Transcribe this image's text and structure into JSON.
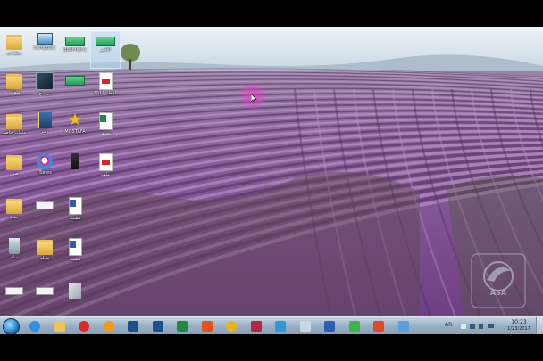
{
  "desktop": {
    "wallpaper": "lavender-field",
    "icons": [
      {
        "name": "folder-icon-1",
        "kind": "folder",
        "label": "مجلداتي"
      },
      {
        "name": "computer-icon",
        "kind": "computer",
        "label": "Computer"
      },
      {
        "name": "green-app-icon-1",
        "kind": "green",
        "label": "Bukhfed-1"
      },
      {
        "name": "green-app-icon-2",
        "kind": "green",
        "label": "الأخير",
        "selected": true
      },
      {
        "name": "folder-icon-2",
        "kind": "folder",
        "label": "ملفات"
      },
      {
        "name": "app-icon-1",
        "kind": "app",
        "label": "برنامج"
      },
      {
        "name": "green-app-icon-3",
        "kind": "green",
        "label": ""
      },
      {
        "name": "pdf-icon-1",
        "kind": "pdf",
        "label": "2017 الخطة"
      },
      {
        "name": "folder-icon-3",
        "kind": "folder",
        "label": "ملفات خاصة"
      },
      {
        "name": "notebook-icon",
        "kind": "notebook",
        "label": "دفتر"
      },
      {
        "name": "star-icon",
        "kind": "star",
        "label": "MOSTAFA"
      },
      {
        "name": "excel-file-icon",
        "kind": "excel",
        "label": "مصنف"
      },
      {
        "name": "folder-icon-4",
        "kind": "folder",
        "label": "صور"
      },
      {
        "name": "itunes-icon",
        "kind": "itunes",
        "label": "iTunes"
      },
      {
        "name": "phone-icon",
        "kind": "phone",
        "label": ""
      },
      {
        "name": "pdf-icon-2",
        "kind": "pdf",
        "label": "ملف"
      },
      {
        "name": "folder-icon-5",
        "kind": "folder",
        "label": "جديد"
      },
      {
        "name": "card-icon-1",
        "kind": "card",
        "label": ""
      },
      {
        "name": "word-file-icon-1",
        "kind": "word",
        "label": "مستند"
      },
      {
        "name": "recycle-bin-icon",
        "kind": "recycle",
        "label": "سلة"
      },
      {
        "name": "folder-icon-6",
        "kind": "folder",
        "label": "مجلد"
      },
      {
        "name": "word-file-icon-2",
        "kind": "word",
        "label": "مستند"
      },
      {
        "name": "card-icon-2",
        "kind": "card",
        "label": ""
      },
      {
        "name": "card-icon-3",
        "kind": "card",
        "label": ""
      },
      {
        "name": "shortcut-icon",
        "kind": "shortcut",
        "label": ""
      }
    ]
  },
  "taskbar": {
    "items": [
      {
        "name": "internet-explorer-icon",
        "color": "#2f8fe0"
      },
      {
        "name": "file-explorer-icon",
        "color": "#e9c45a"
      },
      {
        "name": "opera-icon",
        "color": "#e0262c"
      },
      {
        "name": "media-player-icon",
        "color": "#f39a1b"
      },
      {
        "name": "photoshop-icon-1",
        "color": "#1d4f8c"
      },
      {
        "name": "photoshop-icon-2",
        "color": "#1d4f8c"
      },
      {
        "name": "excel-icon",
        "color": "#1f8a43"
      },
      {
        "name": "pdf-reader-icon",
        "color": "#e2531c"
      },
      {
        "name": "chrome-icon",
        "color": "#e8b21c"
      },
      {
        "name": "access-icon",
        "color": "#b32743"
      },
      {
        "name": "screen-tool-icon",
        "color": "#2b9ad6"
      },
      {
        "name": "folder-window-icon",
        "color": "#c9d7e4"
      },
      {
        "name": "word-icon",
        "color": "#2c5fb3"
      },
      {
        "name": "camtasia-icon",
        "color": "#3bb54a"
      },
      {
        "name": "camtasia-recorder-icon",
        "color": "#e2472a"
      },
      {
        "name": "network-tool-icon",
        "color": "#5aa0d8"
      }
    ],
    "language": "AR",
    "clock": {
      "time": "10:23",
      "date": "1/23/2017"
    }
  },
  "watermark": {
    "text": "ASA"
  },
  "colors": {
    "taskbar": "#97adc2",
    "lavender": "#8a6a9a",
    "sky": "#dfe9f0"
  }
}
